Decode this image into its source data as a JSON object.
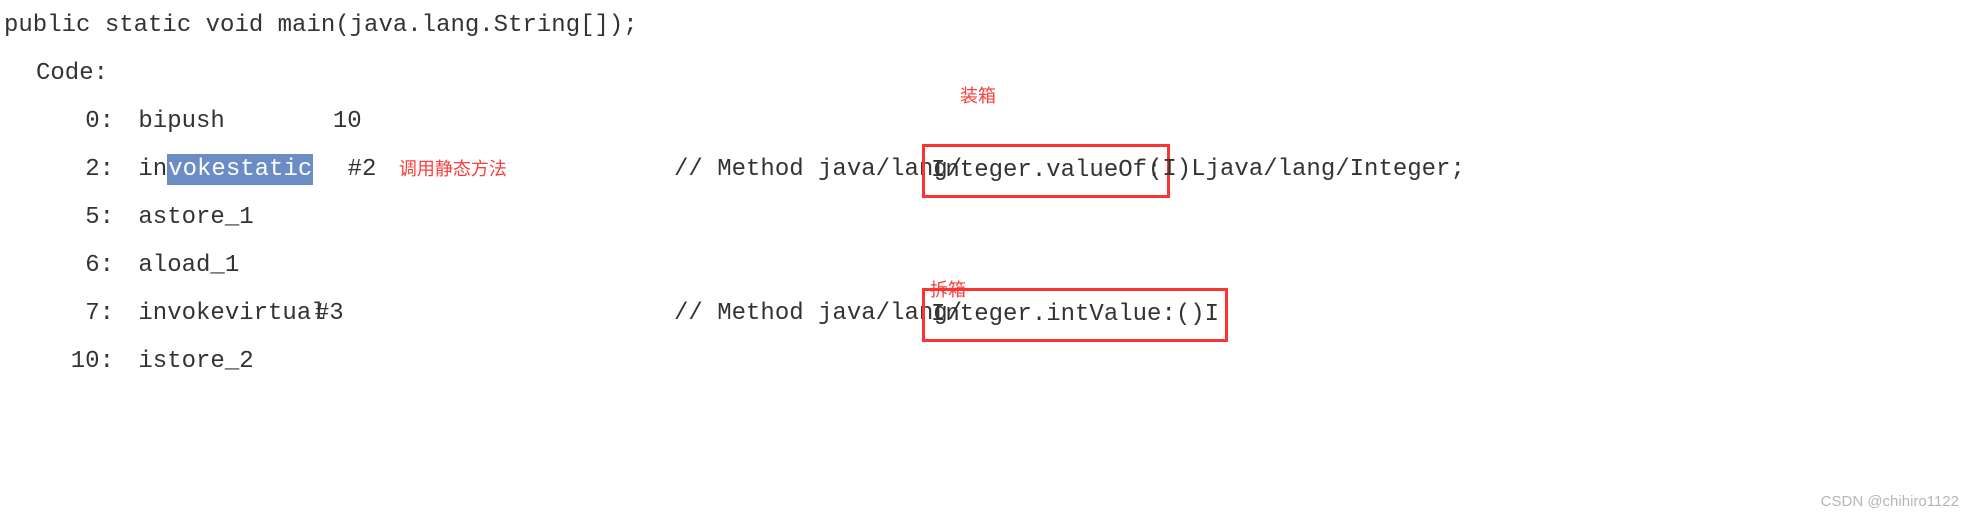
{
  "signature": "public static void main(java.lang.String[]);",
  "code_label": "Code:",
  "lines": {
    "l0": {
      "num": "0:",
      "op": "bipush",
      "arg": "10"
    },
    "l2": {
      "num": "2:",
      "op_pre": "in",
      "op_hl": "vokestatic",
      "arg": "#2",
      "comment_pre": "// Method java/lang/",
      "box": "Integer.valueOf:",
      "comment_post": "(I)Ljava/lang/Integer;"
    },
    "l5": {
      "num": "5:",
      "op": "astore_1"
    },
    "l6": {
      "num": "6:",
      "op": "aload_1"
    },
    "l7": {
      "num": "7:",
      "op": "invokevirtual",
      "arg": "#3",
      "comment_pre": "// Method java/lang/",
      "box": "Integer.intValue:()I"
    },
    "l10": {
      "num": "10:",
      "op": "istore_2"
    }
  },
  "annotations": {
    "call_static": "调用静态方法",
    "boxing": "装箱",
    "unboxing": "拆箱"
  },
  "watermark": "CSDN @chihiro1122"
}
